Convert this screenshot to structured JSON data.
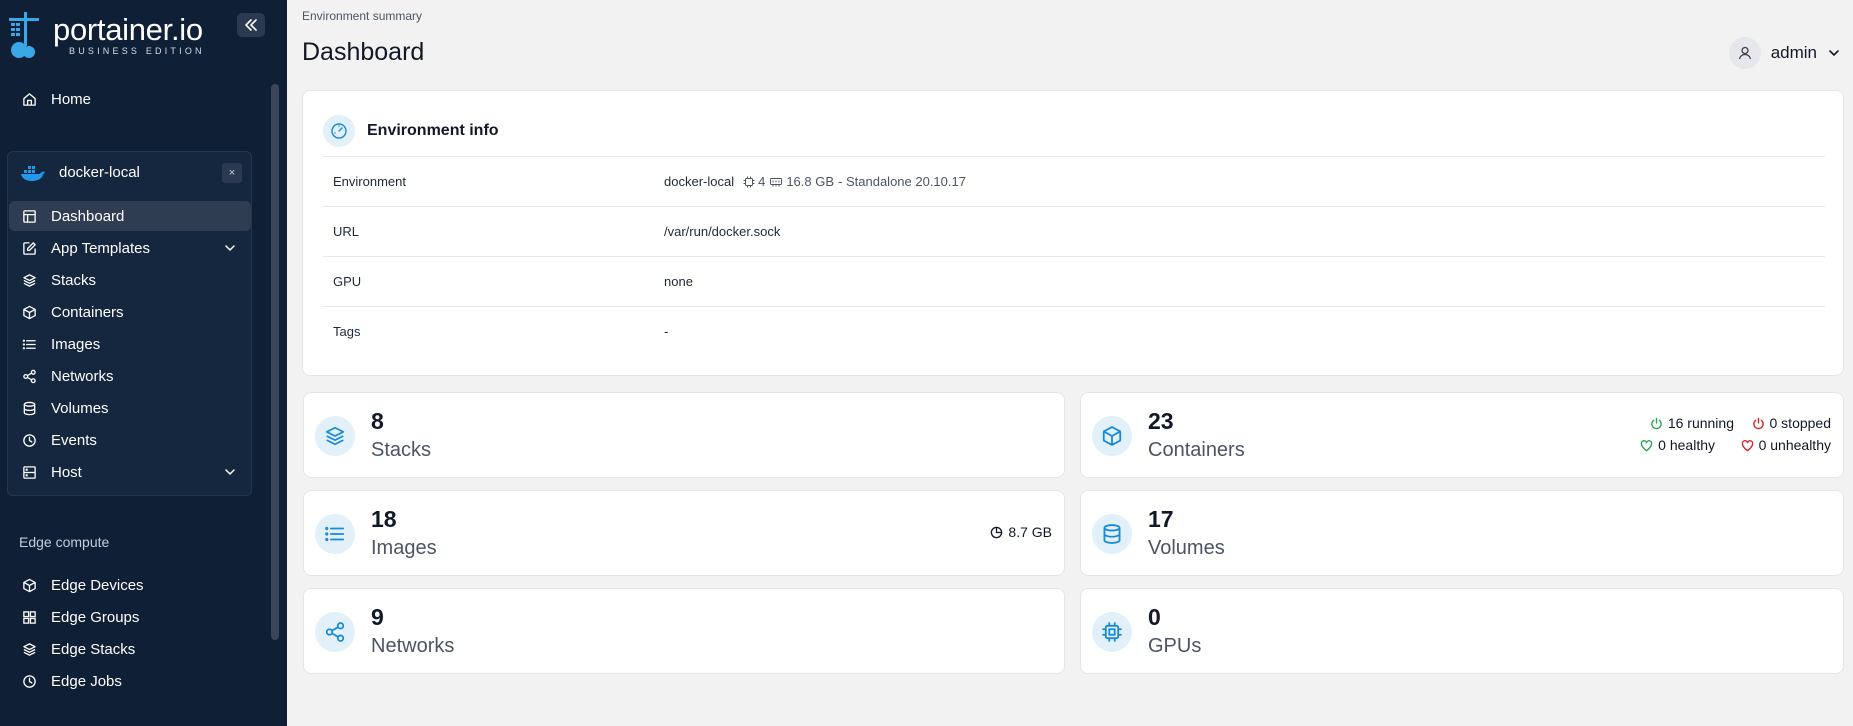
{
  "brand": {
    "name": "portainer.io",
    "edition": "BUSINESS EDITION"
  },
  "sidebar": {
    "home": "Home",
    "environment": {
      "name": "docker-local",
      "close": "×",
      "items": [
        {
          "label": "Dashboard"
        },
        {
          "label": "App Templates"
        },
        {
          "label": "Stacks"
        },
        {
          "label": "Containers"
        },
        {
          "label": "Images"
        },
        {
          "label": "Networks"
        },
        {
          "label": "Volumes"
        },
        {
          "label": "Events"
        },
        {
          "label": "Host"
        }
      ]
    },
    "edge_section": "Edge compute",
    "edge_items": [
      {
        "label": "Edge Devices"
      },
      {
        "label": "Edge Groups"
      },
      {
        "label": "Edge Stacks"
      },
      {
        "label": "Edge Jobs"
      }
    ]
  },
  "header": {
    "breadcrumb": "Environment summary",
    "title": "Dashboard",
    "user": "admin"
  },
  "env_info": {
    "title": "Environment info",
    "rows": [
      {
        "key": "Environment",
        "value": "docker-local",
        "cpus": "4",
        "memory": "16.8 GB",
        "type": "- Standalone 20.10.17"
      },
      {
        "key": "URL",
        "value": "/var/run/docker.sock"
      },
      {
        "key": "GPU",
        "value": "none"
      },
      {
        "key": "Tags",
        "value": "-"
      }
    ]
  },
  "stats": {
    "stacks": {
      "count": "8",
      "label": "Stacks"
    },
    "containers": {
      "count": "23",
      "label": "Containers",
      "running": "16 running",
      "stopped": "0 stopped",
      "healthy": "0 healthy",
      "unhealthy": "0 unhealthy"
    },
    "images": {
      "count": "18",
      "label": "Images",
      "size": "8.7 GB"
    },
    "volumes": {
      "count": "17",
      "label": "Volumes"
    },
    "networks": {
      "count": "9",
      "label": "Networks"
    },
    "gpus": {
      "count": "0",
      "label": "GPUs"
    }
  },
  "colors": {
    "sidebar_bg": "#0f1f36",
    "accent": "#1a8ad4",
    "running": "#2ea44f",
    "stopped": "#d1242f"
  }
}
